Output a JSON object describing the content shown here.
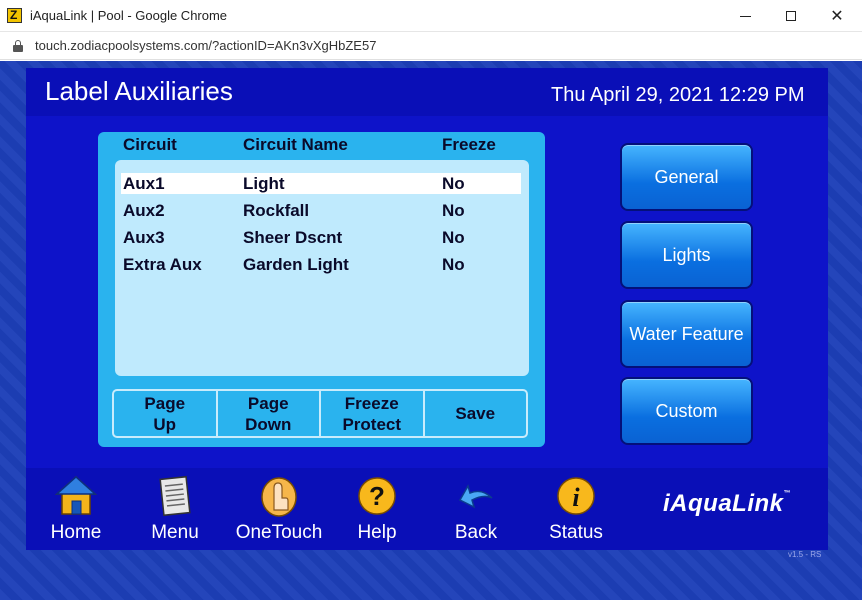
{
  "browser": {
    "window_title": "iAquaLink | Pool - Google Chrome",
    "url": "touch.zodiacpoolsystems.com/?actionID=AKn3vXgHbZE57",
    "minimize": "—",
    "close": "✕"
  },
  "header": {
    "title": "Label Auxiliaries",
    "datetime": "Thu April 29, 2021 12:29 PM"
  },
  "table": {
    "columns": [
      "Circuit",
      "Circuit Name",
      "Freeze"
    ],
    "rows": [
      {
        "circuit": "Aux1",
        "name": "Light",
        "freeze": "No"
      },
      {
        "circuit": "Aux2",
        "name": "Rockfall",
        "freeze": "No"
      },
      {
        "circuit": "Aux3",
        "name": "Sheer Dscnt",
        "freeze": "No"
      },
      {
        "circuit": "Extra Aux",
        "name": "Garden Light",
        "freeze": "No"
      }
    ],
    "selected_row": 0
  },
  "action_buttons": {
    "page_up": "Page\nUp",
    "page_down": "Page\nDown",
    "freeze_protect": "Freeze\nProtect",
    "save": "Save"
  },
  "side_buttons": [
    "General",
    "Lights",
    "Water Feature",
    "Custom"
  ],
  "nav": [
    {
      "label": "Home",
      "icon": "home-icon"
    },
    {
      "label": "Menu",
      "icon": "menu-icon"
    },
    {
      "label": "OneTouch",
      "icon": "onetouch-icon"
    },
    {
      "label": "Help",
      "icon": "help-icon"
    },
    {
      "label": "Back",
      "icon": "back-icon"
    },
    {
      "label": "Status",
      "icon": "status-icon"
    }
  ],
  "brand": {
    "logo": "iAquaLink",
    "trademark": "™",
    "version": "v1.5 - RS"
  },
  "colors": {
    "page_bg": "#1d3fb8",
    "device_bg": "#0e13c9",
    "panel": "#2ab3ee",
    "list_bg": "#bfeafd",
    "button_blue": "#0a6fe0"
  }
}
